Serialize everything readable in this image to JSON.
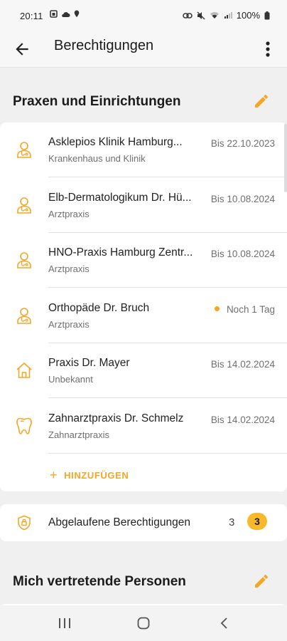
{
  "status_bar": {
    "time": "20:11",
    "battery": "100%"
  },
  "app_bar": {
    "title": "Berechtigungen"
  },
  "sections": {
    "practices_title": "Praxen und Einrichtungen",
    "representatives_title": "Mich vertretende Personen"
  },
  "practices": [
    {
      "name": "Asklepios Klinik Hamburg...",
      "type": "Krankenhaus und Klinik",
      "date": "Bis 22.10.2023",
      "icon": "doctor-icon"
    },
    {
      "name": "Elb-Dermatologikum Dr. Hü...",
      "type": "Arztpraxis",
      "date": "Bis 10.08.2024",
      "icon": "doctor-icon"
    },
    {
      "name": "HNO-Praxis Hamburg Zentr...",
      "type": "Arztpraxis",
      "date": "Bis 10.08.2024",
      "icon": "doctor-icon"
    },
    {
      "name": "Orthopäde Dr. Bruch",
      "type": "Arztpraxis",
      "date": "Noch 1 Tag",
      "icon": "doctor-icon",
      "warning": true
    },
    {
      "name": "Praxis Dr. Mayer",
      "type": "Unbekannt",
      "date": "Bis 14.02.2024",
      "icon": "house-icon"
    },
    {
      "name": "Zahnarztpraxis Dr. Schmelz",
      "type": "Zahnarztpraxis",
      "date": "Bis 14.02.2024",
      "icon": "tooth-icon"
    }
  ],
  "add_button": {
    "label": "HINZUFÜGEN"
  },
  "expired": {
    "label": "Abgelaufene Berechtigungen",
    "count": "3",
    "badge": "3"
  },
  "colors": {
    "accent": "#f5a623",
    "background": "#f0f0f1",
    "card": "#ffffff",
    "text_primary": "#222222",
    "text_secondary": "#6f6f6f"
  }
}
